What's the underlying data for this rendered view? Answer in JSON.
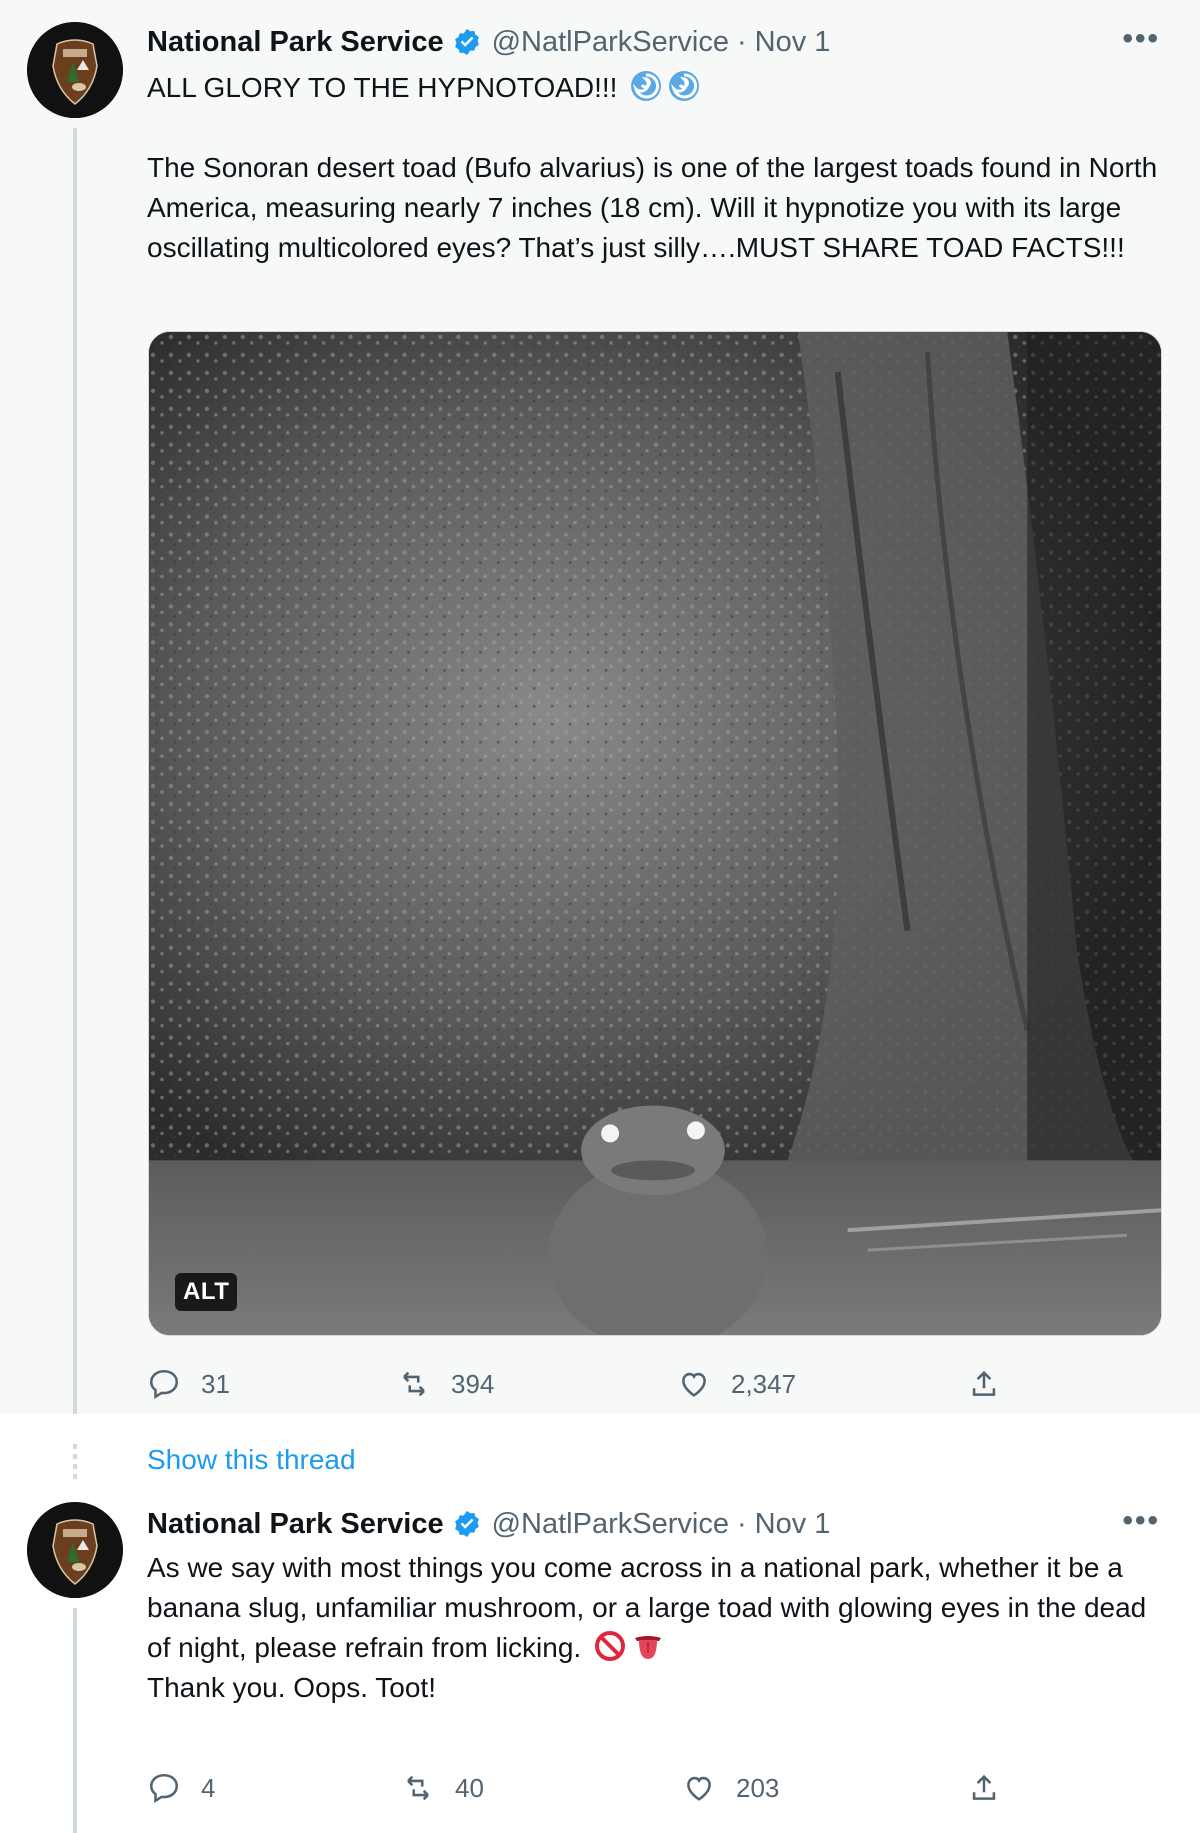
{
  "tweet1": {
    "author": {
      "name": "National Park Service",
      "handle": "@NatlParkService",
      "date": "Nov 1",
      "separator": "·",
      "verified": true
    },
    "more_label": "•••",
    "headline": "ALL GLORY TO THE HYPNOTOAD!!!",
    "headline_emoji": [
      "cyclone-emoji",
      "cyclone-emoji"
    ],
    "body": "The Sonoran desert toad (Bufo alvarius) is one of the largest toads found in North America, measuring nearly 7 inches (18 cm). Will it hypnotize you with its large oscillating multicolored eyes? That’s just silly….MUST SHARE TOAD FACTS!!!",
    "media": {
      "alt_badge": "ALT",
      "image_kind": "night-camera-photo-toad"
    },
    "actions": {
      "replies": "31",
      "retweets": "394",
      "likes": "2,347"
    }
  },
  "show_thread": "Show this thread",
  "tweet2": {
    "author": {
      "name": "National Park Service",
      "handle": "@NatlParkService",
      "date": "Nov 1",
      "separator": "·",
      "verified": true
    },
    "more_label": "•••",
    "body": "As we say with most things you come across in a national park, whether it be a banana slug, unfamiliar mushroom, or a large toad with glowing eyes in the dead of night, please refrain from licking.",
    "body_emoji": [
      "prohibited-emoji",
      "tongue-emoji"
    ],
    "body2": "Thank you. Oops. Toot!",
    "actions": {
      "replies": "4",
      "retweets": "40",
      "likes": "203"
    }
  },
  "colors": {
    "accent": "#1d9bf0",
    "muted": "#536471",
    "text": "#0f1419",
    "nps_brown": "#7a4a22"
  }
}
